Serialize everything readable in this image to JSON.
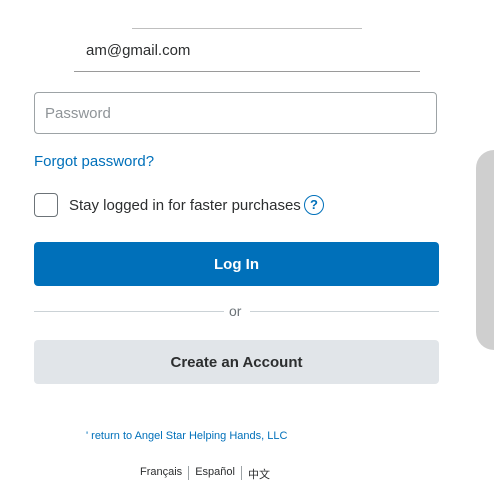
{
  "login_form": {
    "email_value": "am@gmail.com",
    "password_placeholder": "Password",
    "forgot_password": "Forgot password?",
    "stay_logged_in": "Stay logged in for faster purchases",
    "help_glyph": "?",
    "login_button": "Log In",
    "divider_text": "or",
    "create_account_button": "Create an Account"
  },
  "footer": {
    "return_link": "' return to Angel Star Helping Hands, LLC",
    "languages": [
      "Français",
      "Español",
      "中文"
    ]
  },
  "colors": {
    "accent": "#0070ba",
    "secondary_button": "#e1e5e9"
  },
  "icons": {
    "help": "question-circle-icon"
  }
}
